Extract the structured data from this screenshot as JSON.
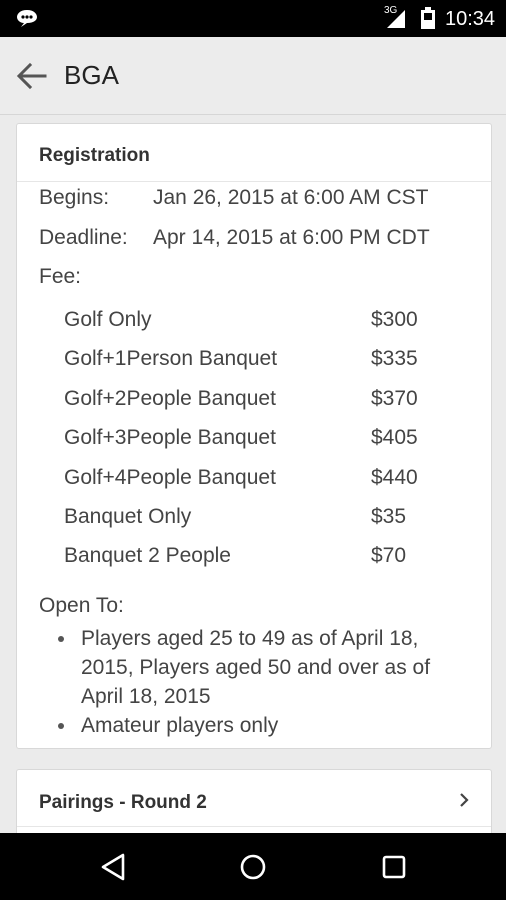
{
  "status_bar": {
    "network": "3G",
    "time": "10:34",
    "icons": [
      "notification-icon",
      "signal-icon",
      "battery-icon"
    ]
  },
  "app_bar": {
    "title": "BGA",
    "back_icon": "back-arrow-icon"
  },
  "registration": {
    "title": "Registration",
    "begins_label": "Begins:",
    "begins_value": "Jan 26, 2015 at 6:00 AM CST",
    "deadline_label": "Deadline:",
    "deadline_value": "Apr 14, 2015 at 6:00 PM CDT",
    "fee_label": "Fee:",
    "fees": [
      {
        "name": "Golf Only",
        "price": "$300"
      },
      {
        "name": "Golf+1Person Banquet",
        "price": "$335"
      },
      {
        "name": "Golf+2People Banquet",
        "price": "$370"
      },
      {
        "name": "Golf+3People Banquet",
        "price": "$405"
      },
      {
        "name": "Golf+4People Banquet",
        "price": "$440"
      },
      {
        "name": "Banquet Only",
        "price": "$35"
      },
      {
        "name": "Banquet 2 People",
        "price": "$70"
      }
    ],
    "open_to_label": "Open To:",
    "open_to": [
      "Players aged 25 to 49 as of April 18, 2015, Players aged 50 and over as of April 18, 2015",
      "Amateur players only"
    ]
  },
  "pairings": {
    "title": "Pairings - Round 2",
    "chevron_icon": "chevron-right-icon"
  },
  "nav_bar": {
    "buttons": [
      "back-triangle-icon",
      "home-circle-icon",
      "recents-square-icon"
    ]
  }
}
